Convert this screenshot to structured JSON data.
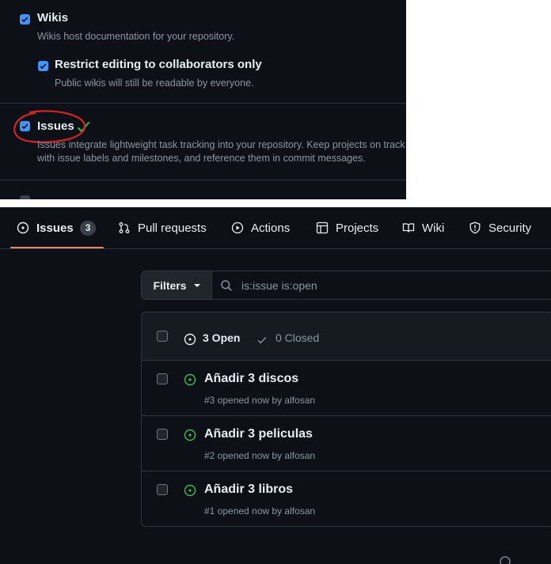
{
  "settings": {
    "wikis": {
      "title": "Wikis",
      "desc": "Wikis host documentation for your repository.",
      "checked": true
    },
    "restrict": {
      "title": "Restrict editing to collaborators only",
      "desc": "Public wikis will still be readable by everyone.",
      "checked": true
    },
    "issues": {
      "title": "Issues",
      "desc": "Issues integrate lightweight task tracking into your repository. Keep projects on track with issue labels and milestones, and reference them in commit messages.",
      "checked": true
    },
    "annotation_color": "#d22525",
    "check_color": "#3fb950"
  },
  "tabs": [
    {
      "label": "Issues",
      "icon": "issue-opened-icon",
      "count": "3",
      "selected": true
    },
    {
      "label": "Pull requests",
      "icon": "git-pull-request-icon"
    },
    {
      "label": "Actions",
      "icon": "play-icon"
    },
    {
      "label": "Projects",
      "icon": "table-icon"
    },
    {
      "label": "Wiki",
      "icon": "book-icon"
    },
    {
      "label": "Security",
      "icon": "shield-icon"
    }
  ],
  "filter": {
    "button_label": "Filters",
    "query": "is:issue is:open"
  },
  "list_header": {
    "open_label": "3 Open",
    "closed_label": "0 Closed"
  },
  "issues": [
    {
      "title": "Añadir 3 discos",
      "meta": "#3 opened now by alfosan"
    },
    {
      "title": "Añadir 3 peliculas",
      "meta": "#2 opened now by alfosan"
    },
    {
      "title": "Añadir 3 libros",
      "meta": "#1 opened now by alfosan"
    }
  ],
  "colors": {
    "bg": "#0d1117",
    "border": "#30363d",
    "accent_open": "#3fb950",
    "tab_underline": "#f78166",
    "checkbox": "#4493f8"
  }
}
